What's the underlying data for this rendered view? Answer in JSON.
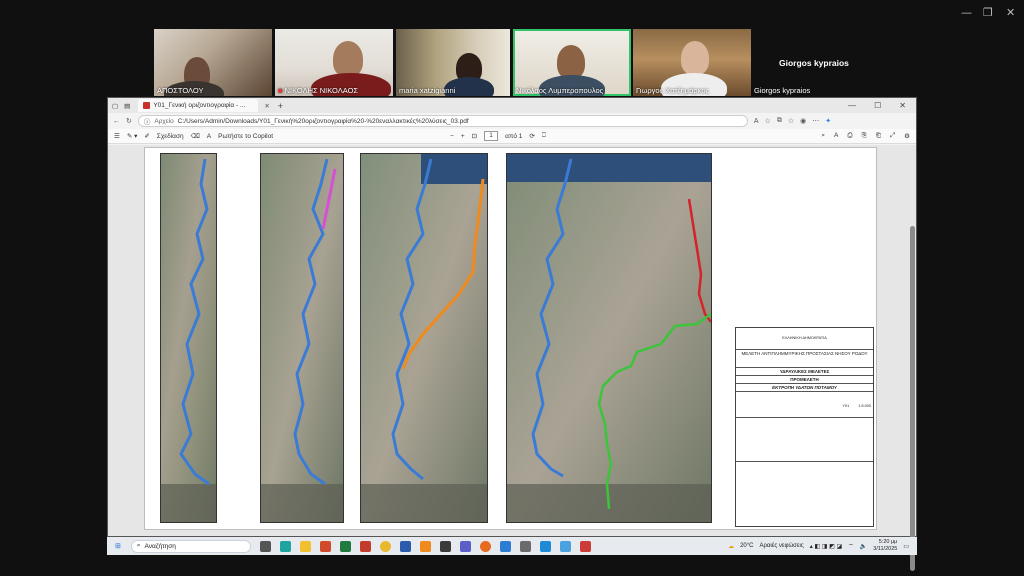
{
  "participants": [
    {
      "name": "ΑΠΟΣΤΟΛΟΥ",
      "mic_off": false
    },
    {
      "name": "ΝΙΚΟΛΗΣ ΝΙΚΟΛΑΟΣ",
      "mic_off": true
    },
    {
      "name": "maria xatzigianni",
      "mic_off": false
    },
    {
      "name": "Νικόλαος Λυμπεροπουλος",
      "mic_off": false,
      "speaking": true
    },
    {
      "name": "Γιωργος Χατζημάρκος",
      "mic_off": false
    }
  ],
  "no_video_participant": {
    "display_name": "Giorgos kypraios",
    "label": "Giorgos kypraios"
  },
  "browser": {
    "tab_title": "Υ01_Γενική οριζοντιογραφία - ...",
    "url": "C:/Users/Admin/Downloads/Υ01_Γενική%20οριζοντιογραφία%20-%20εναλλακτικές%20λύσεις_03.pdf",
    "url_prefix": "Αρχείο",
    "pdf_toolbar": {
      "draw_label": "Σχεδίαση",
      "copilot_label": "Ρωτήστε το Copilot",
      "page_current": "1",
      "page_total": "από 1"
    }
  },
  "drawing": {
    "header": "ΥΔΡΑΥΛΙΚΕΣ ΜΕΛΕΤΕΣ",
    "subheader": "ΠΡΟΜΕΛΕΤΗ",
    "title": "ΕΚΤΡΟΠΗ ΥΔΑΤΩΝ ΠΟΤΑΜΟΥ",
    "scale": "1:5.000",
    "study_title": "ΜΕΛΕΤΗ ΑΝΤΙΠΛΗΜΜΥΡΙΚΗΣ ΠΡΟΣΤΑΣΙΑΣ ΝΗΣΟΥ ΡΟΔΟΥ",
    "authority": "ΕΛΛΗΝΙΚΗ ΔΗΜΟΚΡΑΤΙΑ",
    "drawing_no": "Υ01",
    "route_colors": {
      "main": "#3a7bd5",
      "alt_pink": "#d64fd6",
      "alt_orange": "#f08a1c",
      "alt_red": "#d4232a",
      "alt_green": "#3cc43a"
    }
  },
  "taskbar": {
    "search_placeholder": "Αναζήτηση",
    "weather": "20°C",
    "weather_desc": "Αραιές νεφώσεις",
    "time": "5:20 μμ",
    "date": "3/11/2025"
  }
}
